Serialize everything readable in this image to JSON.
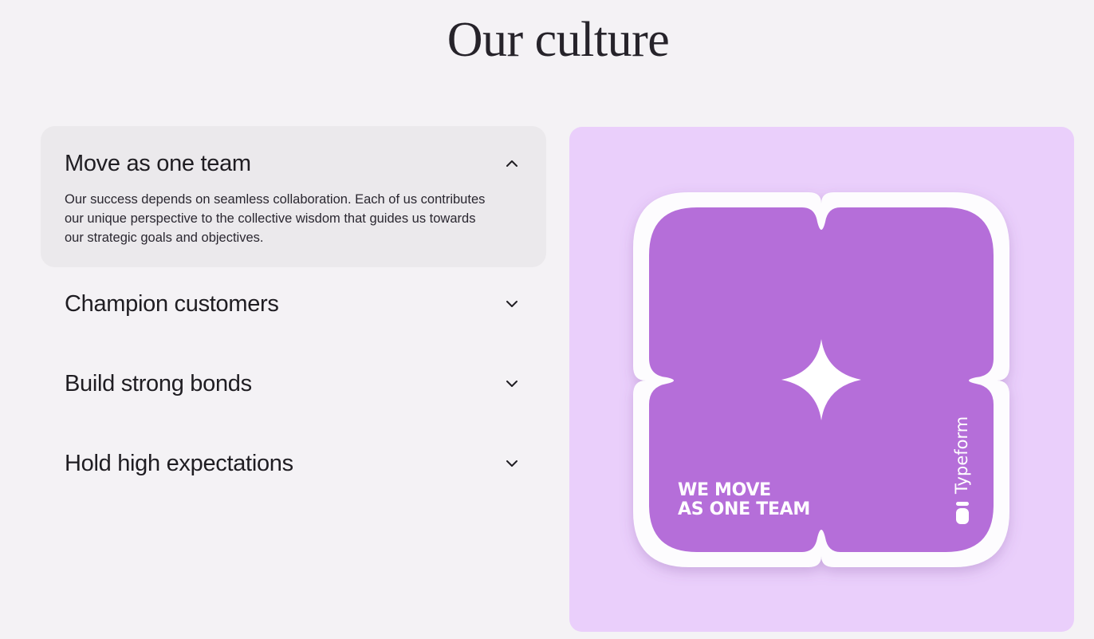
{
  "heading": "Our culture",
  "accordion": {
    "items": [
      {
        "title": "Move as one team",
        "body": "Our success depends on seamless collaboration. Each of us contributes our unique perspective to the collective wisdom that guides us towards our strategic goals and objectives.",
        "expanded": true,
        "icon": "chevron-up-icon"
      },
      {
        "title": "Champion customers",
        "expanded": false,
        "icon": "chevron-down-icon"
      },
      {
        "title": "Build strong bonds",
        "expanded": false,
        "icon": "chevron-down-icon"
      },
      {
        "title": "Hold high expectations",
        "expanded": false,
        "icon": "chevron-down-icon"
      }
    ]
  },
  "media": {
    "caption_line1": "WE MOVE",
    "caption_line2": "AS ONE TEAM",
    "brand": "Typeform",
    "colors": {
      "card_background": "#eacffb",
      "sticker_fill": "#b56ed9",
      "sticker_border": "#ffffff"
    }
  },
  "colors": {
    "page_background": "#f4f2f5",
    "open_item_background": "#ebe9ec",
    "text": "#1f1d22"
  }
}
